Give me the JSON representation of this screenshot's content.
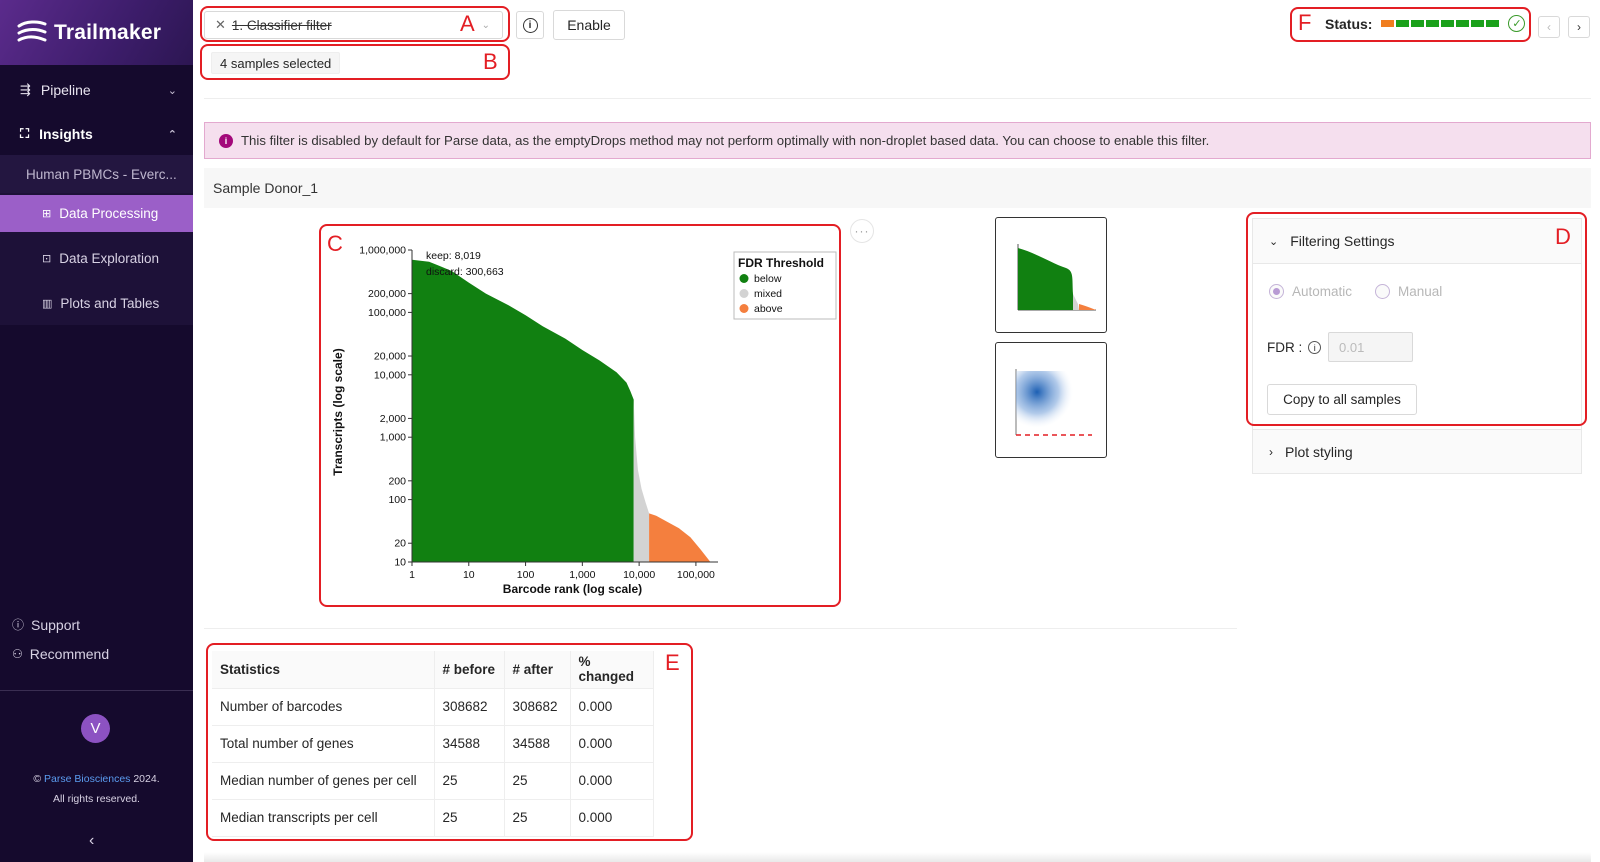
{
  "app": {
    "name": "Trailmaker"
  },
  "sidebar": {
    "pipeline_label": "Pipeline",
    "insights_label": "Insights",
    "dataset_label": "Human PBMCs - Everc...",
    "items": [
      {
        "label": "Data Processing"
      },
      {
        "label": "Data Exploration"
      },
      {
        "label": "Plots and Tables"
      }
    ],
    "support_label": "Support",
    "recommend_label": "Recommend",
    "avatar_initial": "V",
    "copyright_prefix": "©",
    "copyright_brand": "Parse Biosciences",
    "copyright_year": "2024.",
    "copyright_rights": "All rights reserved."
  },
  "toolbar": {
    "filter_name": "1. Classifier filter",
    "enable_label": "Enable",
    "samples_selected": "4 samples selected",
    "status_label": "Status:",
    "status_segments": [
      "#f07d1e",
      "#1aa01a",
      "#1aa01a",
      "#1aa01a",
      "#1aa01a",
      "#1aa01a",
      "#1aa01a",
      "#1aa01a"
    ]
  },
  "annotations": {
    "a": "A",
    "b": "B",
    "c": "C",
    "d": "D",
    "e": "E",
    "f": "F"
  },
  "alert": {
    "text": "This filter is disabled by default for Parse data, as the emptyDrops method may not perform optimally with non-droplet based data. You can choose to enable this filter."
  },
  "sample": {
    "header": "Sample Donor_1"
  },
  "chart_data": {
    "type": "area",
    "xlabel": "Barcode rank (log scale)",
    "ylabel": "Transcripts (log scale)",
    "x_scale": "log",
    "y_scale": "log",
    "xlim": [
      1,
      200000
    ],
    "ylim": [
      10,
      1000000
    ],
    "x_ticks": [
      "1",
      "10",
      "100",
      "1,000",
      "10,000",
      "100,000"
    ],
    "y_ticks": [
      "10",
      "20",
      "100",
      "200",
      "1,000",
      "2,000",
      "10,000",
      "20,000",
      "100,000",
      "200,000",
      "1,000,000"
    ],
    "annotations": [
      "keep: 8,019",
      "discard: 300,663"
    ],
    "legend": {
      "title": "FDR Threshold",
      "position": "top-right",
      "entries": [
        {
          "label": "below",
          "color": "#118011"
        },
        {
          "label": "mixed",
          "color": "#d3d3d3"
        },
        {
          "label": "above",
          "color": "#f47f3e"
        }
      ]
    },
    "series": [
      {
        "name": "below",
        "color": "#118011",
        "x": [
          1,
          2,
          3,
          5,
          10,
          20,
          50,
          100,
          200,
          500,
          1000,
          2000,
          4000,
          6000,
          7000,
          8019
        ],
        "y": [
          700000,
          650000,
          560000,
          460000,
          300000,
          200000,
          130000,
          90000,
          60000,
          38000,
          25000,
          17000,
          11000,
          7500,
          5500,
          4000
        ]
      },
      {
        "name": "mixed",
        "color": "#d3d3d3",
        "x": [
          8019,
          8500,
          9500,
          11000,
          13000,
          15000
        ],
        "y": [
          4000,
          1000,
          300,
          150,
          90,
          60
        ]
      },
      {
        "name": "above",
        "color": "#f47f3e",
        "x": [
          15000,
          20000,
          30000,
          50000,
          80000,
          120000,
          180000
        ],
        "y": [
          60,
          55,
          45,
          35,
          25,
          16,
          10
        ]
      }
    ]
  },
  "settings": {
    "filtering_title": "Filtering Settings",
    "automatic_label": "Automatic",
    "manual_label": "Manual",
    "fdr_label": "FDR :",
    "fdr_value": "0.01",
    "copy_button": "Copy to all samples",
    "plot_styling_title": "Plot styling"
  },
  "stats": {
    "headers": [
      "Statistics",
      "# before",
      "# after",
      "% changed"
    ],
    "rows": [
      [
        "Number of barcodes",
        "308682",
        "308682",
        "0.000"
      ],
      [
        "Total number of genes",
        "34588",
        "34588",
        "0.000"
      ],
      [
        "Median number of genes per cell",
        "25",
        "25",
        "0.000"
      ],
      [
        "Median transcripts per cell",
        "25",
        "25",
        "0.000"
      ]
    ]
  }
}
